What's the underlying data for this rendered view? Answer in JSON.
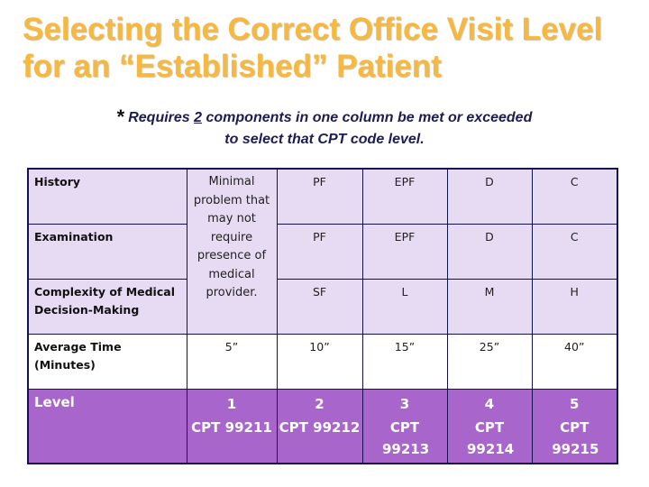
{
  "title": {
    "line1": "Selecting the Correct Office Visit Level",
    "line2": "for an “Established” Patient"
  },
  "note": {
    "star": "*",
    "part1": "Requires ",
    "underlined": "2",
    "part2": " components in one column be met or exceeded",
    "line2": "to select that CPT code level."
  },
  "table": {
    "rows": [
      {
        "label": "History",
        "values": [
          "PF",
          "EPF",
          "D",
          "C"
        ]
      },
      {
        "label": "Examination",
        "values": [
          "PF",
          "EPF",
          "D",
          "C"
        ]
      },
      {
        "label": "Complexity of Medical Decision-Making",
        "values": [
          "SF",
          "L",
          "M",
          "H"
        ]
      }
    ],
    "level1_description": "Minimal problem that may not require presence of medical provider.",
    "avg_time": {
      "label": "Average Time (Minutes)",
      "values": [
        "5”",
        "10”",
        "15”",
        "25”",
        "40”"
      ]
    },
    "level": {
      "label": "Level",
      "levels": [
        {
          "num": "1",
          "code": "CPT 99211"
        },
        {
          "num": "2",
          "code": "CPT 99212"
        },
        {
          "num": "3",
          "code": "CPT 99213"
        },
        {
          "num": "4",
          "code": "CPT 99214"
        },
        {
          "num": "5",
          "code": "CPT 99215"
        }
      ]
    }
  },
  "colors": {
    "title": "#f5b942",
    "table_light": "#e7daf3",
    "level_row": "#a865cc",
    "border": "#14124a"
  }
}
